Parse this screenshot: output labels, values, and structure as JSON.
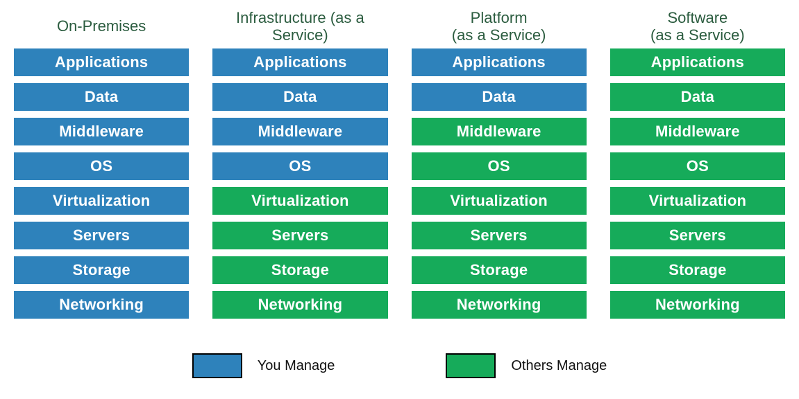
{
  "colors": {
    "you_manage": "#2e82bb",
    "others_manage": "#16ab5a",
    "header_text": "#2b5c3f"
  },
  "layers": [
    "Applications",
    "Data",
    "Middleware",
    "OS",
    "Virtualization",
    "Servers",
    "Storage",
    "Networking"
  ],
  "columns": [
    {
      "title": "On-Premises",
      "ownership": [
        "you",
        "you",
        "you",
        "you",
        "you",
        "you",
        "you",
        "you"
      ]
    },
    {
      "title": "Infrastructure (as a\nService)",
      "ownership": [
        "you",
        "you",
        "you",
        "you",
        "other",
        "other",
        "other",
        "other"
      ]
    },
    {
      "title": "Platform\n(as a Service)",
      "ownership": [
        "you",
        "you",
        "other",
        "other",
        "other",
        "other",
        "other",
        "other"
      ]
    },
    {
      "title": "Software\n(as a Service)",
      "ownership": [
        "other",
        "other",
        "other",
        "other",
        "other",
        "other",
        "other",
        "other"
      ]
    }
  ],
  "legend": {
    "you": "You Manage",
    "other": "Others Manage"
  }
}
